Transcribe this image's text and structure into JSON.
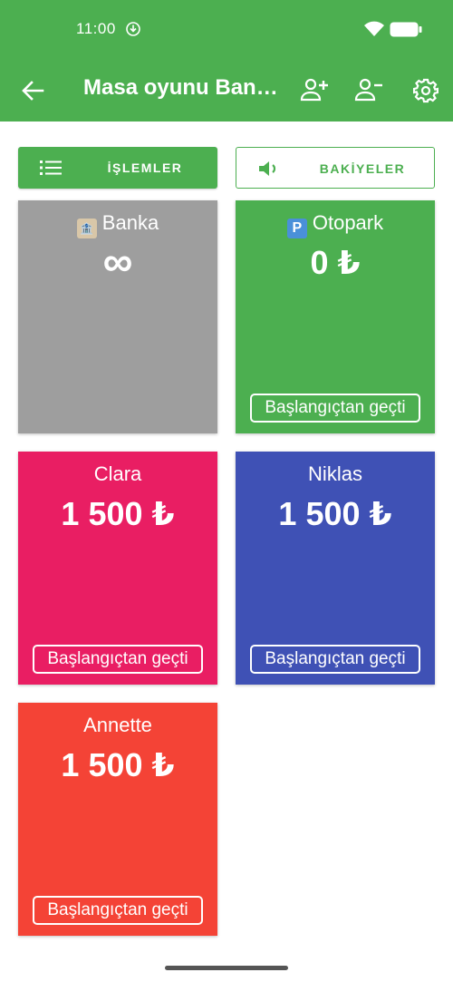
{
  "status": {
    "time": "11:00"
  },
  "header": {
    "title": "Masa oyunu Ban…"
  },
  "buttons": {
    "transactions": "İŞLEMLER",
    "balances": "BAKİYELER"
  },
  "cards": [
    {
      "name": "Banka",
      "amount": "∞",
      "color": "#9e9e9e",
      "icon": "bank-emoji"
    },
    {
      "name": "Otopark",
      "amount": "0 ₺",
      "color": "#4caf50",
      "icon": "parking-emoji",
      "pass": "Başlangıçtan geçti"
    },
    {
      "name": "Clara",
      "amount": "1 500 ₺",
      "color": "#e91e63",
      "pass": "Başlangıçtan geçti"
    },
    {
      "name": "Niklas",
      "amount": "1 500 ₺",
      "color": "#3f51b5",
      "pass": "Başlangıçtan geçti"
    },
    {
      "name": "Annette",
      "amount": "1 500 ₺",
      "color": "#f44336",
      "pass": "Başlangıçtan geçti"
    }
  ],
  "colors": {
    "primary": "#4caf50"
  }
}
